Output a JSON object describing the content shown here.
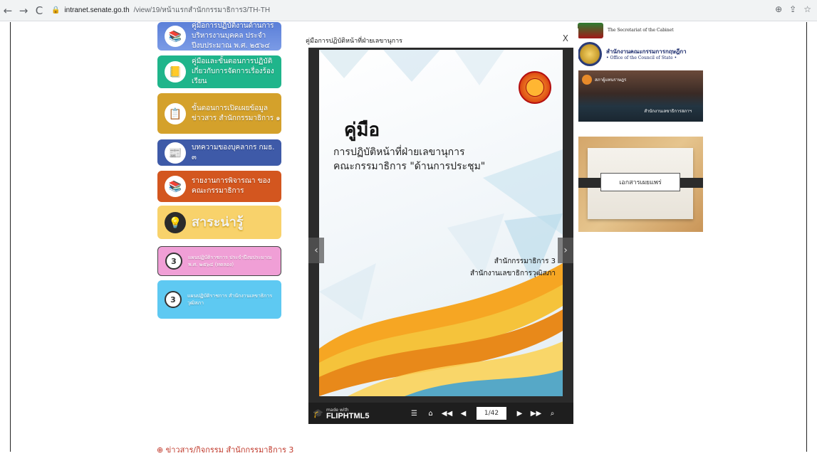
{
  "browser": {
    "url_host": "intranet.senate.go.th",
    "url_path": "/view/19/หน้าแรกสำนักกรรมาธิการ3/TH-TH"
  },
  "left_banners": [
    {
      "text": "คู่มือการปฏิบัติงานด้านการบริหารงานบุคคล ประจำปีงบประมาณ พ.ศ. ๒๕๖๔"
    },
    {
      "text": "คู่มือและขั้นตอนการปฏิบัติ เกี่ยวกับการจัดการเรื่องร้องเรียน"
    },
    {
      "text": "ขั้นตอนการเปิดเผยข้อมูลข่าวสาร สำนักกรรมาธิการ ๑"
    },
    {
      "text": "บทความของบุคลากร กมธ. ๓"
    },
    {
      "text": "รายงานการพิจารณา ของคณะกรรมาธิการ"
    },
    {
      "text": "สาระน่ารู้"
    },
    {
      "text": "แผนปฏิบัติราชการ ประจำปีงบประมาณ พ.ศ. ๒๕๖๔ (ทดลอง)"
    },
    {
      "text": "แผนปฏิบัติราชการ สำนักงานเลขาธิการวุฒิสภา"
    }
  ],
  "modal": {
    "title": "คู่มือการปฏิบัติหน้าที่ฝ่ายเลขานุการ",
    "close": "X",
    "cover_title": "คู่มือ",
    "cover_sub1": "การปฏิบัติหน้าที่ฝ่ายเลขานุการ",
    "cover_sub2": "คณะกรรมาธิการ \"ด้านการประชุม\"",
    "cover_org1": "สำนักกรรมาธิการ 3",
    "cover_org2": "สำนักงานเลขาธิการวุฒิสภา",
    "made_with": "made with",
    "fliphtml5": "FLIPHTML5",
    "page_indicator": "1/42"
  },
  "right_col": {
    "secretariat_en": "The Secretariat of the Cabinet",
    "council_th": "สำนักงานคณะกรรมการกฤษฎีกา",
    "council_en": "• Office of the Council of State •",
    "photo_label": "สภาผู้แทนราษฎร",
    "photo_caption": "สำนักงานเลขาธิการสภาฯ",
    "doc_label": "เอกสารเผยแพร่"
  },
  "news_heading": "⊕ ข่าวสาร/กิจกรรม สำนักกรรมาธิการ 3"
}
